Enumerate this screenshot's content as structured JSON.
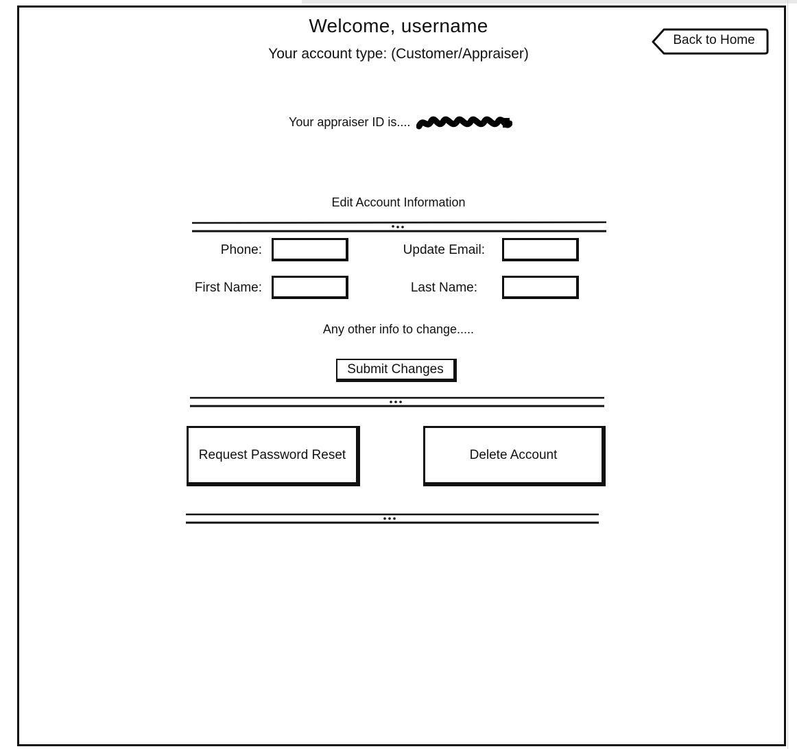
{
  "header": {
    "title": "Welcome, username",
    "subtitle": "Your account type: (Customer/Appraiser)"
  },
  "nav": {
    "back_label": "Back to Home"
  },
  "appraiser": {
    "label": "Your appraiser ID is...."
  },
  "edit_section": {
    "title": "Edit Account Information",
    "phone_label": "Phone:",
    "email_label": "Update Email:",
    "first_name_label": "First Name:",
    "last_name_label": "Last Name:",
    "phone_value": "",
    "email_value": "",
    "first_name_value": "",
    "last_name_value": "",
    "other_info": "Any other info to change.....",
    "submit_label": "Submit Changes"
  },
  "account_actions": {
    "reset_label": "Request Password Reset",
    "delete_label": "Delete Account"
  },
  "colors": {
    "ink": "#111111",
    "background": "#ffffff"
  }
}
